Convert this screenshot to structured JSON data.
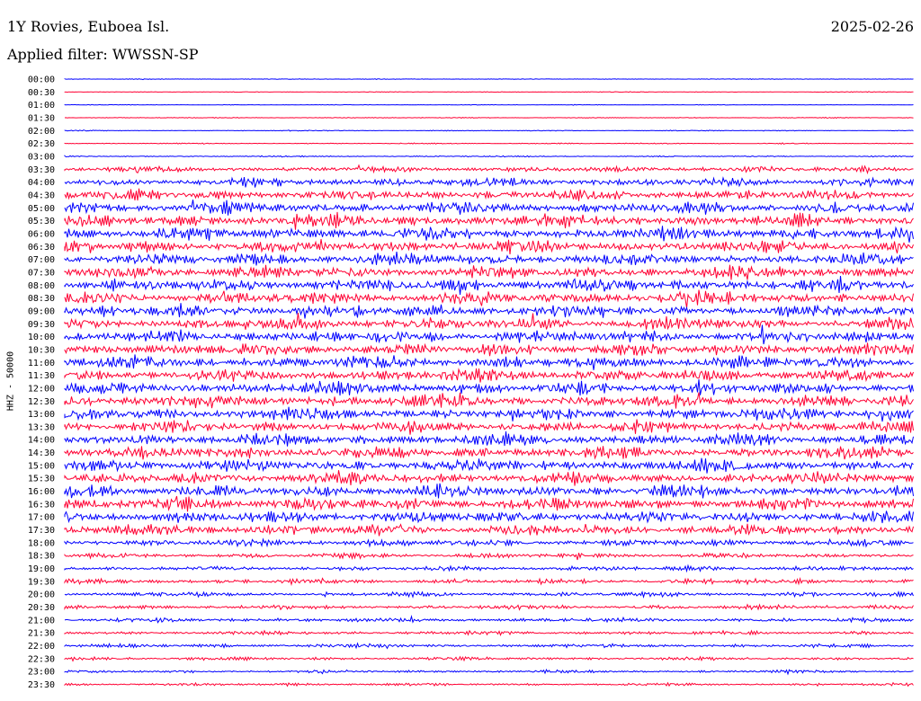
{
  "header": {
    "station": "1Y Rovies, Euboea Isl.",
    "date": "2025-02-26",
    "filter": "Applied filter: WWSSN-SP"
  },
  "colors": {
    "background": "#ffffff",
    "trace_even": "#0000ff",
    "trace_odd": "#ff0033",
    "text": "#000000"
  },
  "chart_data": {
    "type": "line",
    "title": "1Y Rovies, Euboea Isl.",
    "subtitle": "Applied filter: WWSSN-SP",
    "ylabel": "HHZ - 50000",
    "xlabel": "",
    "grid": false,
    "legend": "none",
    "row_interval_minutes": 30,
    "row_labels": [
      "00:00",
      "00:30",
      "01:00",
      "01:30",
      "02:00",
      "02:30",
      "03:00",
      "03:30",
      "04:00",
      "04:30",
      "05:00",
      "05:30",
      "06:00",
      "06:30",
      "07:00",
      "07:30",
      "08:00",
      "08:30",
      "09:00",
      "09:30",
      "10:00",
      "10:30",
      "11:00",
      "11:30",
      "12:00",
      "12:30",
      "13:00",
      "13:30",
      "14:00",
      "14:30",
      "15:00",
      "15:30",
      "16:00",
      "16:30",
      "17:00",
      "17:30",
      "18:00",
      "18:30",
      "19:00",
      "19:30",
      "20:00",
      "20:30",
      "21:00",
      "21:30",
      "22:00",
      "22:30",
      "23:00",
      "23:30"
    ],
    "relative_amplitude": [
      0.05,
      0.06,
      0.05,
      0.06,
      0.07,
      0.08,
      0.1,
      0.45,
      0.7,
      0.85,
      0.95,
      1.0,
      1.0,
      1.0,
      1.0,
      1.0,
      1.0,
      1.0,
      1.0,
      1.0,
      1.0,
      1.0,
      1.0,
      1.0,
      1.0,
      1.0,
      1.0,
      0.95,
      0.95,
      0.95,
      0.95,
      0.95,
      0.95,
      0.95,
      0.95,
      0.9,
      0.55,
      0.4,
      0.38,
      0.38,
      0.38,
      0.36,
      0.34,
      0.3,
      0.3,
      0.25,
      0.22,
      0.22
    ]
  }
}
